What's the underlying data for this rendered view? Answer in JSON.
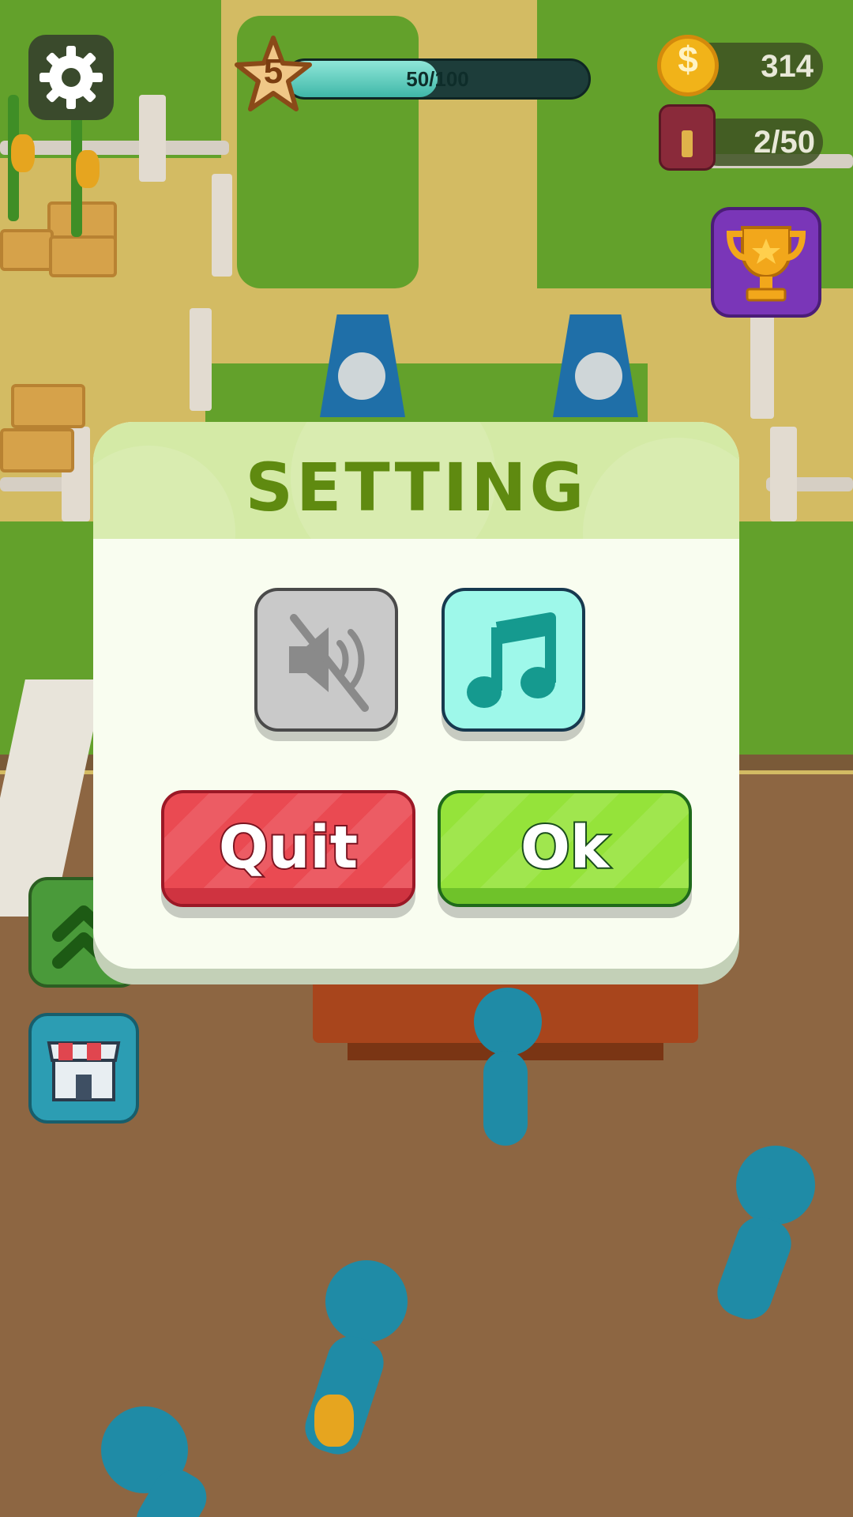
{
  "hud": {
    "level": "5",
    "xp_text": "50/100",
    "xp_progress": 0.5,
    "coins": "314",
    "bag_text": "2/50"
  },
  "icons": {
    "settings": "gear-icon",
    "coin": "dollar-coin-icon",
    "bag": "backpack-icon",
    "trophy": "trophy-icon",
    "upgrade": "double-chevron-up-icon",
    "shop": "shop-icon",
    "sound": "speaker-muted-icon",
    "music": "music-note-icon",
    "coin_symbol": "$"
  },
  "dialog": {
    "title": "SETTING",
    "sound_enabled": false,
    "music_enabled": true,
    "quit_label": "Quit",
    "ok_label": "Ok"
  },
  "colors": {
    "dialog_header": "#d4eaa6",
    "title": "#5f8a10",
    "quit": "#ea4a52",
    "ok": "#95e33a",
    "music_on": "#9ef8ea",
    "sound_off": "#c9c9c9"
  }
}
